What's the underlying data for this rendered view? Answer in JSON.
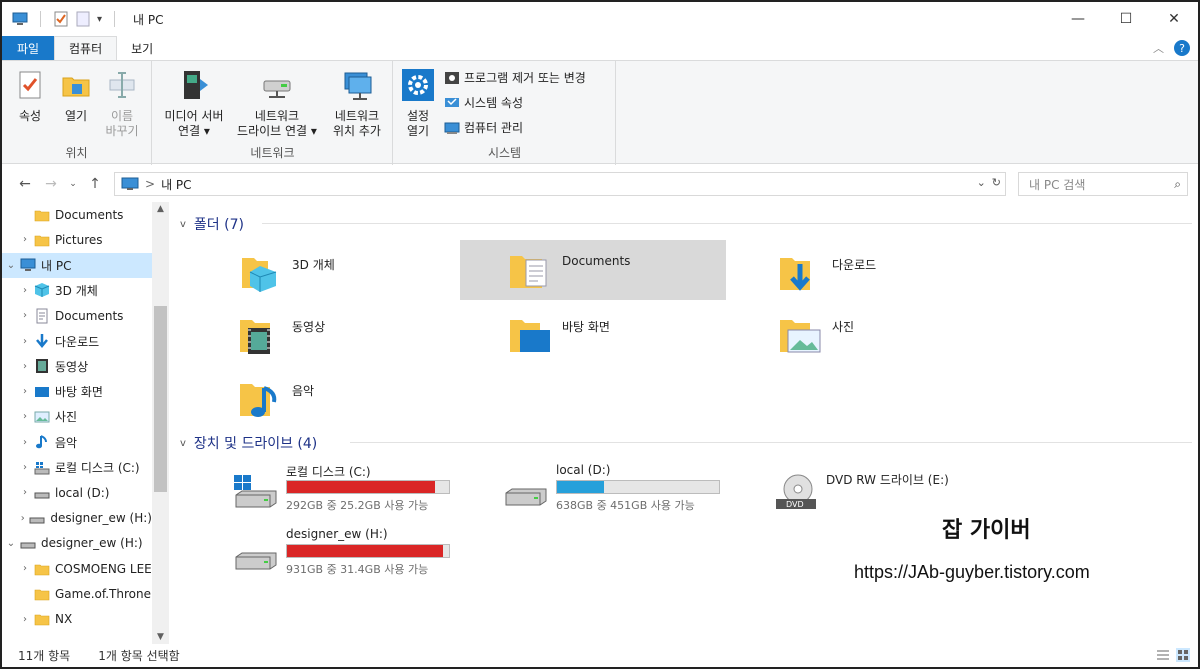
{
  "window": {
    "title": "내 PC",
    "controls": {
      "minimize": "—",
      "maximize": "☐",
      "close": "✕"
    }
  },
  "ribbon_tabs": [
    {
      "label": "파일"
    },
    {
      "label": "컴퓨터"
    },
    {
      "label": "보기"
    }
  ],
  "ribbon": {
    "location": {
      "label": "위치",
      "properties": "속성",
      "open": "열기",
      "rename_1": "이름",
      "rename_2": "바꾸기"
    },
    "network": {
      "label": "네트워크",
      "media_1": "미디어 서버",
      "media_2": "연결 ▾",
      "map_1": "네트워크",
      "map_2": "드라이브 연결 ▾",
      "add_1": "네트워크",
      "add_2": "위치 추가"
    },
    "system": {
      "label": "시스템",
      "settings_1": "설정",
      "settings_2": "열기",
      "uninstall": "프로그램 제거 또는 변경",
      "sysprops": "시스템 속성",
      "manage": "컴퓨터 관리"
    }
  },
  "address": {
    "crumb": "내 PC",
    "separator": ">",
    "search_placeholder": "내 PC 검색"
  },
  "nav_pane": [
    {
      "label": "Documents",
      "icon": "folder-icon",
      "indent": 1,
      "chevron": ""
    },
    {
      "label": "Pictures",
      "icon": "folder-icon",
      "indent": 1,
      "chevron": ">"
    },
    {
      "label": "내 PC",
      "icon": "computer-icon",
      "indent": 0,
      "chevron": "v",
      "selected": true
    },
    {
      "label": "3D 개체",
      "icon": "3d-objects-icon",
      "indent": 1,
      "chevron": ">"
    },
    {
      "label": "Documents",
      "icon": "documents-icon",
      "indent": 1,
      "chevron": ">"
    },
    {
      "label": "다운로드",
      "icon": "download-icon",
      "indent": 1,
      "chevron": ">"
    },
    {
      "label": "동영상",
      "icon": "video-icon",
      "indent": 1,
      "chevron": ">"
    },
    {
      "label": "바탕 화면",
      "icon": "desktop-icon",
      "indent": 1,
      "chevron": ">"
    },
    {
      "label": "사진",
      "icon": "pictures-icon",
      "indent": 1,
      "chevron": ">"
    },
    {
      "label": "음악",
      "icon": "music-icon",
      "indent": 1,
      "chevron": ">"
    },
    {
      "label": "로컬 디스크 (C:)",
      "icon": "windows-drive-icon",
      "indent": 1,
      "chevron": ">"
    },
    {
      "label": "local (D:)",
      "icon": "drive-icon",
      "indent": 1,
      "chevron": ">"
    },
    {
      "label": "designer_ew (H:)",
      "icon": "drive-icon",
      "indent": 1,
      "chevron": ">"
    },
    {
      "label": "designer_ew (H:)",
      "icon": "drive-icon",
      "indent": 0,
      "chevron": "v"
    },
    {
      "label": "COSMOENG LEE",
      "icon": "folder-icon",
      "indent": 1,
      "chevron": ">"
    },
    {
      "label": "Game.of.Throne",
      "icon": "folder-icon",
      "indent": 1,
      "chevron": ""
    },
    {
      "label": "NX",
      "icon": "folder-icon",
      "indent": 1,
      "chevron": ">"
    }
  ],
  "folders_section": {
    "title": "폴더 (7)",
    "chevron": "v"
  },
  "folders": [
    {
      "label": "3D 개체",
      "icon": "3d-objects-folder-icon"
    },
    {
      "label": "Documents",
      "icon": "documents-folder-icon",
      "selected": true
    },
    {
      "label": "다운로드",
      "icon": "downloads-folder-icon"
    },
    {
      "label": "동영상",
      "icon": "videos-folder-icon"
    },
    {
      "label": "바탕 화면",
      "icon": "desktop-folder-icon"
    },
    {
      "label": "사진",
      "icon": "pictures-folder-icon"
    },
    {
      "label": "음악",
      "icon": "music-folder-icon"
    }
  ],
  "drives_section": {
    "title": "장치 및 드라이브 (4)",
    "chevron": "v"
  },
  "drives": [
    {
      "label": "로컬 디스크 (C:)",
      "info": "292GB 중 25.2GB 사용 가능",
      "used_fraction": 0.914,
      "bar_color": "#da2626",
      "icon": "windows-drive-icon"
    },
    {
      "label": "local (D:)",
      "info": "638GB 중 451GB 사용 가능",
      "used_fraction": 0.293,
      "bar_color": "#26a0da",
      "icon": "drive-icon"
    },
    {
      "label": "DVD RW 드라이브 (E:)",
      "info": "",
      "icon": "dvd-drive-icon"
    },
    {
      "label": "designer_ew (H:)",
      "info": "931GB 중 31.4GB 사용 가능",
      "used_fraction": 0.966,
      "bar_color": "#da2626",
      "icon": "drive-icon"
    }
  ],
  "watermark": {
    "title": "잡 가이버",
    "url": "https://JAb-guyber.tistory.com"
  },
  "status": {
    "count": "11개 항목",
    "selection": "1개 항목 선택함"
  },
  "colors": {
    "accent": "#1979ca",
    "selection": "#cce8ff",
    "section_title": "#1e3287"
  }
}
